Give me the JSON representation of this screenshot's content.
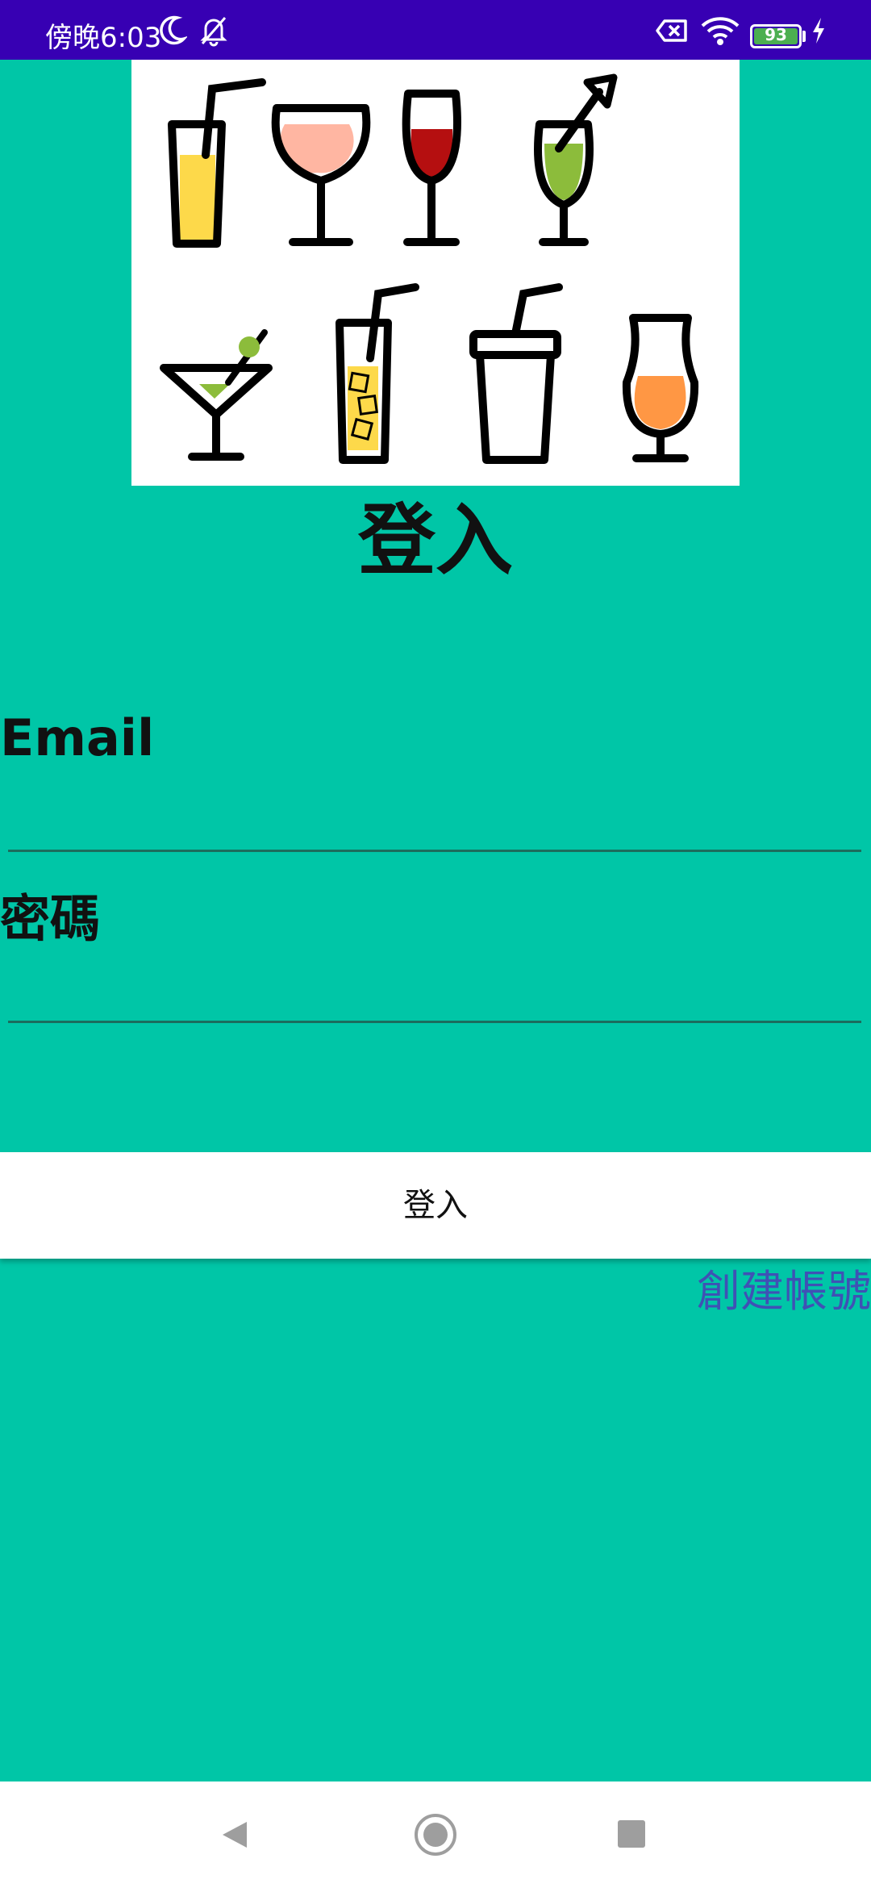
{
  "status_bar": {
    "time": "傍晚6:03",
    "battery_level": "93",
    "icons": [
      "moon-icon",
      "bell-off-icon",
      "sim-blocked-icon",
      "wifi-icon",
      "battery-icon",
      "charging-icon"
    ]
  },
  "hero": {
    "icons": [
      "juice-glass-icon",
      "wine-glass-icon",
      "red-wine-glass-icon",
      "cocktail-umbrella-icon",
      "martini-glass-icon",
      "iced-drink-icon",
      "cup-with-straw-icon",
      "beer-glass-icon"
    ]
  },
  "login": {
    "title": "登入",
    "email_label": "Email",
    "email_value": "",
    "password_label": "密碼",
    "password_value": "",
    "submit_label": "登入",
    "create_account_label": "創建帳號"
  },
  "colors": {
    "background": "#00c6a7",
    "status_bar": "#3700b3",
    "link": "#3f51b5"
  },
  "nav_bar": {
    "icons": [
      "back-icon",
      "home-icon",
      "recents-icon"
    ]
  }
}
